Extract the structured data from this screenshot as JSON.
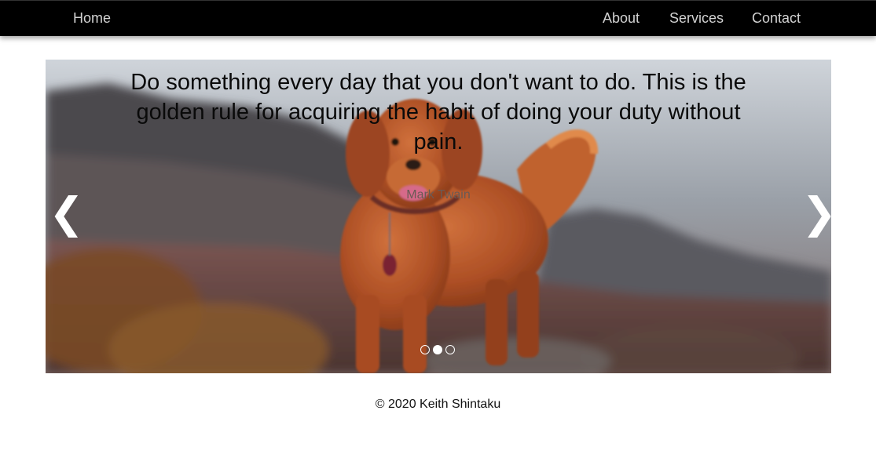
{
  "nav": {
    "home": "Home",
    "about": "About",
    "services": "Services",
    "contact": "Contact"
  },
  "carousel": {
    "quote": "Do something every day that you don't want to do. This is the golden rule for acquiring the habit of doing your duty without pain.",
    "author": "Mark Twain",
    "prev_arrow": "❮",
    "next_arrow": "❯",
    "slide_count": 3,
    "active_slide": 2
  },
  "footer": {
    "text": "© 2020  Keith Shintaku"
  },
  "colors": {
    "navbar_bg": "#000000",
    "nav_text": "#d2d2d2",
    "arrow": "#ffffff",
    "dog_fur": "#b5552a"
  }
}
